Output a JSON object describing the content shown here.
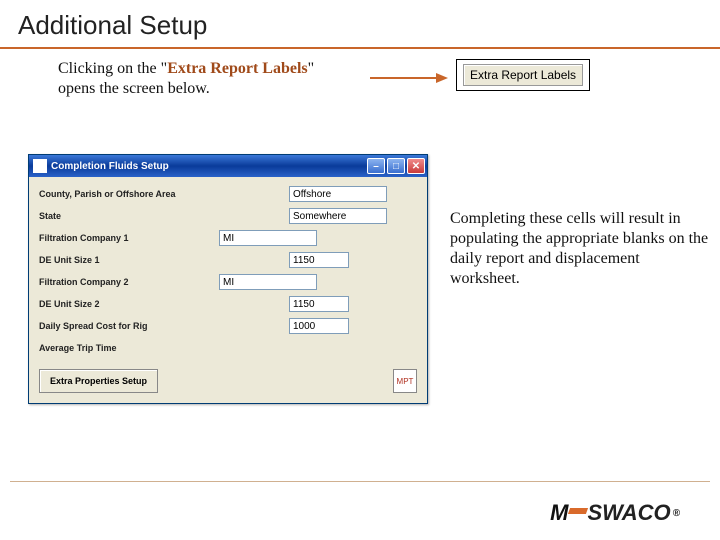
{
  "page": {
    "title": "Additional Setup",
    "intro_before": "Clicking on the \"",
    "intro_highlight": "Extra Report Labels",
    "intro_after": "\" opens the screen below.",
    "right_text": "Completing these cells will result in populating the appropriate blanks on the daily report and displacement worksheet."
  },
  "erl_button": {
    "label": "Extra Report Labels"
  },
  "window": {
    "title": "Completion Fluids Setup",
    "fields": {
      "county": {
        "label": "County, Parish or Offshore Area",
        "value": "Offshore"
      },
      "state": {
        "label": "State",
        "value": "Somewhere"
      },
      "filt1": {
        "label": "Filtration Company 1",
        "value": "MI"
      },
      "de1": {
        "label": "DE Unit Size 1",
        "value": "1150"
      },
      "filt2": {
        "label": "Filtration Company 2",
        "value": "MI"
      },
      "de2": {
        "label": "DE Unit Size 2",
        "value": "1150"
      },
      "spread": {
        "label": "Daily Spread Cost for Rig",
        "value": "1000"
      },
      "trip": {
        "label": "Average Trip Time",
        "value": ""
      }
    },
    "eps_button": "Extra Properties Setup",
    "mpt_icon": "MPT"
  },
  "logo": {
    "brand1": "M",
    "brand2": "SWACO",
    "tm": "®"
  }
}
